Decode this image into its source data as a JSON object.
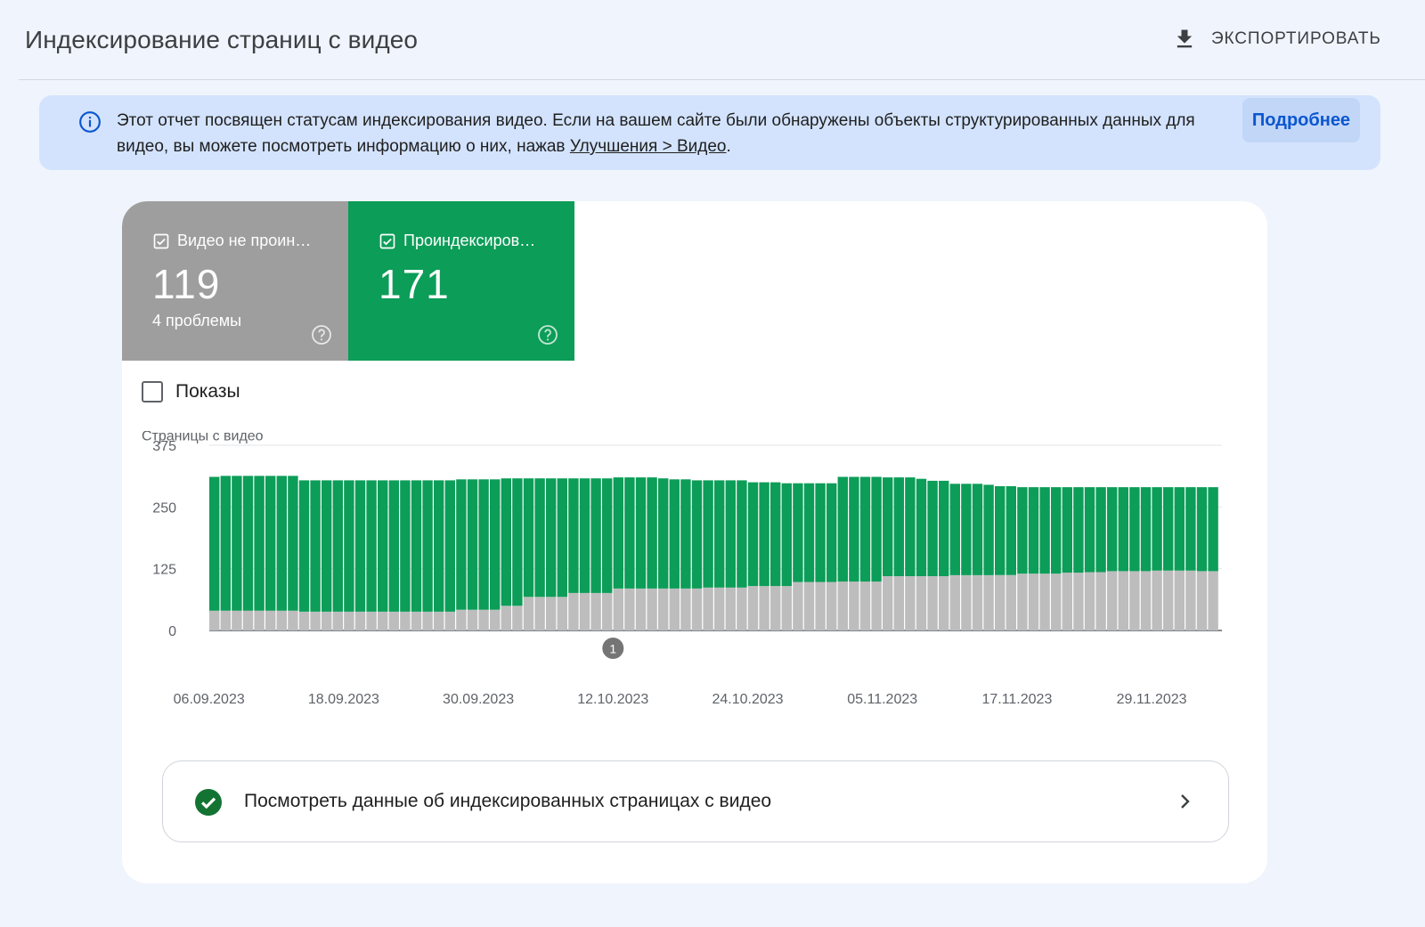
{
  "header": {
    "title": "Индексирование страниц с видео",
    "export_label": "ЭКСПОРТИРОВАТЬ"
  },
  "banner": {
    "text_before": "Этот отчет посвящен статусам индексирования видео. Если на вашем сайте были обнаружены объекты структурированных данных для видео, вы можете посмотреть информацию о них, нажав ",
    "link_text": "Улучшения > Видео",
    "text_after": ".",
    "more_label": "Подробнее"
  },
  "tiles": [
    {
      "label": "Видео не проин…",
      "value": "119",
      "sub": "4 проблемы",
      "color": "#9e9e9e"
    },
    {
      "label": "Проиндексиров…",
      "value": "171",
      "sub": "",
      "color": "#0c9d58"
    }
  ],
  "shows_label": "Показы",
  "chart_data": {
    "type": "bar",
    "stacked": true,
    "ylabel": "Страницы с видео",
    "ylim": [
      0,
      375
    ],
    "yticks": [
      0,
      125,
      250,
      375
    ],
    "xtick_labels": [
      "06.09.2023",
      "18.09.2023",
      "30.09.2023",
      "12.10.2023",
      "24.10.2023",
      "05.11.2023",
      "17.11.2023",
      "29.11.2023"
    ],
    "xtick_index": [
      0,
      12,
      24,
      36,
      48,
      60,
      72,
      84
    ],
    "annotation": {
      "label": "1",
      "index": 36
    },
    "grid": true,
    "series": [
      {
        "color": "#bdbdbd",
        "values": [
          40,
          40,
          40,
          40,
          40,
          40,
          40,
          40,
          38,
          38,
          38,
          38,
          38,
          38,
          38,
          38,
          38,
          38,
          38,
          38,
          38,
          38,
          42,
          42,
          42,
          42,
          50,
          50,
          68,
          68,
          68,
          68,
          76,
          76,
          76,
          76,
          85,
          85,
          85,
          85,
          85,
          85,
          85,
          85,
          87,
          87,
          87,
          87,
          90,
          90,
          90,
          90,
          98,
          98,
          98,
          98,
          99,
          99,
          99,
          99,
          110,
          110,
          110,
          110,
          110,
          110,
          112,
          112,
          112,
          112,
          112,
          112,
          115,
          115,
          115,
          115,
          117,
          117,
          118,
          118,
          120,
          120,
          120,
          120,
          121,
          121,
          121,
          121,
          120,
          120
        ]
      },
      {
        "color": "#0c9d58",
        "values": [
          271,
          273,
          273,
          273,
          273,
          273,
          273,
          273,
          266,
          266,
          266,
          266,
          266,
          266,
          266,
          266,
          266,
          266,
          266,
          266,
          266,
          266,
          264,
          264,
          264,
          264,
          258,
          258,
          240,
          240,
          240,
          240,
          232,
          232,
          232,
          232,
          225,
          225,
          225,
          225,
          223,
          221,
          221,
          219,
          217,
          217,
          217,
          217,
          210,
          210,
          210,
          208,
          200,
          200,
          200,
          200,
          212,
          212,
          212,
          212,
          200,
          200,
          200,
          197,
          193,
          193,
          185,
          185,
          185,
          183,
          180,
          180,
          175,
          175,
          175,
          175,
          173,
          173,
          172,
          172,
          170,
          170,
          170,
          170,
          169,
          169,
          169,
          169,
          170,
          170
        ]
      }
    ]
  },
  "link_row": {
    "label": "Посмотреть данные об индексированных страницах с видео"
  }
}
